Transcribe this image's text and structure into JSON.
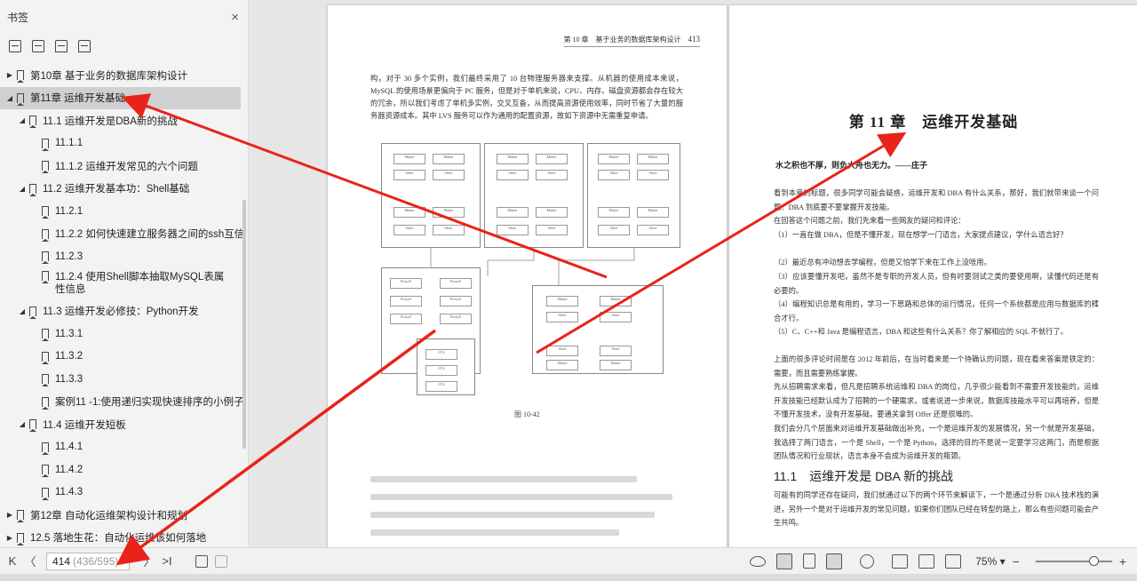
{
  "sidebar": {
    "title": "书签",
    "close": "×",
    "tree": [
      {
        "label": "第10章 基于业务的数据库架构设计",
        "level": 0,
        "expand": "▶",
        "selected": false
      },
      {
        "label": "第11章 运维开发基础",
        "level": 0,
        "expand": "◢",
        "selected": true
      },
      {
        "label": "11.1 运维开发是DBA新的挑战",
        "level": 1,
        "expand": "◢",
        "selected": false
      },
      {
        "label": "11.1.1",
        "level": 2,
        "expand": "",
        "selected": false
      },
      {
        "label": "11.1.2 运维开发常见的六个问题",
        "level": 2,
        "expand": "",
        "selected": false
      },
      {
        "label": "11.2 运维开发基本功：Shell基础",
        "level": 1,
        "expand": "◢",
        "selected": false
      },
      {
        "label": "11.2.1",
        "level": 2,
        "expand": "",
        "selected": false
      },
      {
        "label": "11.2.2 如何快速建立服务器之间的ssh互信",
        "level": 2,
        "expand": "",
        "selected": false
      },
      {
        "label": "11.2.3",
        "level": 2,
        "expand": "",
        "selected": false
      },
      {
        "label": "11.2.4 使用Shell脚本抽取MySQL表属性信息",
        "level": 2,
        "expand": "",
        "selected": false,
        "wrap": true
      },
      {
        "label": "11.3 运维开发必修技：Python开发",
        "level": 1,
        "expand": "◢",
        "selected": false
      },
      {
        "label": "11.3.1",
        "level": 2,
        "expand": "",
        "selected": false
      },
      {
        "label": "11.3.2",
        "level": 2,
        "expand": "",
        "selected": false
      },
      {
        "label": "11.3.3",
        "level": 2,
        "expand": "",
        "selected": false
      },
      {
        "label": "案例11 -1:使用递归实现快速排序的小例子",
        "level": 2,
        "expand": "",
        "selected": false
      },
      {
        "label": "11.4 运维开发短板",
        "level": 1,
        "expand": "◢",
        "selected": false
      },
      {
        "label": "11.4.1",
        "level": 2,
        "expand": "",
        "selected": false
      },
      {
        "label": "11.4.2",
        "level": 2,
        "expand": "",
        "selected": false
      },
      {
        "label": "11.4.3",
        "level": 2,
        "expand": "",
        "selected": false
      },
      {
        "label": "第12章 自动化运维架构设计和规划",
        "level": 0,
        "expand": "▶",
        "selected": false
      },
      {
        "label": "12.5 落地生花：自动化运维该如何落地",
        "level": 0,
        "expand": "▶",
        "selected": false
      }
    ]
  },
  "left_page": {
    "header": "第 10 章　基于业务的数据库架构设计",
    "page_number": "413",
    "para1": "构，对于 30 多个实例，我们最终采用了 10 台物理服务器来支撑。从机器的使用成本来说，MySQL 的使用场景更偏向于 PC 服务，但是对于单机来说，CPU、内存、磁盘资源都会存在较大的冗余，所以我们考虑了单机多实例，交叉互备，从而提高资源使用效率，同时节省了大量的服务器资源成本。其中 LVS 服务可以作为通用的配置资源，故如下资源中无需重复申请。",
    "figure_caption": "图 10-42",
    "figure_labels": {
      "cluster1": "集群1",
      "cluster2": "集群2",
      "master": "Master",
      "slave": "Slave",
      "lvs": "LVS",
      "proxy": "ProxyS"
    }
  },
  "right_page": {
    "chapter_title": "第 11 章　运维开发基础",
    "quote": "水之积也不厚，则负大舟也无力。——庄子",
    "paras": [
      "看到本章的标题，很多同学可能会疑惑，运维开发和 DBA 有什么关系，那好，我们就带来谈一个问题：DBA 到底要不要掌握开发技能。",
      "在回答这个问题之前，我们先来看一些网友的疑问和评论：",
      "（1）一直在做 DBA，但是不懂开发，现在想学一门语言，大家提点建议，学什么语言好？",
      "（2）最近总有冲动想去学编程，但是又怕学下来在工作上没啥用。",
      "（3）应该要懂开发吧，虽然不是专职的开发人员，但有时要测试之类的要使用啊，读懂代码还是有必要的。",
      "（4）编程知识总是有用的，学习一下思路和总体的运行情况，任何一个系统都是应用与数据库的糅合才行。",
      "（5）C、C++和 Java 是编程语言，DBA 和这些有什么关系？你了解相应的 SQL 不就行了。",
      "上面的很多评论时间是在 2012 年前后，在当时看来是一个待确认的问题，现在看来答案是铁定的：需要，而且需要熟练掌握。",
      "先从招聘需求来看，但凡是招聘系统运维和 DBA 的岗位，几乎很少能看到不需要开发技能的，运维开发技能已经默认成为了招聘的一个硬需求，或者说进一步来说，数据库技能水平可以再培养，但是不懂开发技术，没有开发基础，要通关拿到 Offer 还是很难的。",
      "我们会分几个层面来对运维开发基础做出补充，一个是运维开发的发展情况，另一个就是开发基础，我选择了两门语言，一个是 Shell，一个是 Python，选择的目的不是说一定要学习这两门，而是根据团队情况和行业现状，语言本身不会成为运维开发的瓶颈。"
    ],
    "section_title": "11.1　运维开发是 DBA 新的挑战",
    "section_para": "可能有的同学还存在疑问，我们就通过以下的两个环节来解读下，一个是通过分析 DBA 技术栈的演进，另外一个是对于运维开发的常见问题，如果你们团队已经在转型的路上，那么有些问题可能会产生共鸣。"
  },
  "bottombar": {
    "first": "K",
    "prev": "〈",
    "page_current": "414",
    "page_total": "(436/595)",
    "next": "〉",
    "last": ">I",
    "zoom": "75%",
    "zoom_level_percent": 75
  },
  "colors": {
    "selected_row": "#d0d0d0",
    "arrow": "#e8231a"
  }
}
